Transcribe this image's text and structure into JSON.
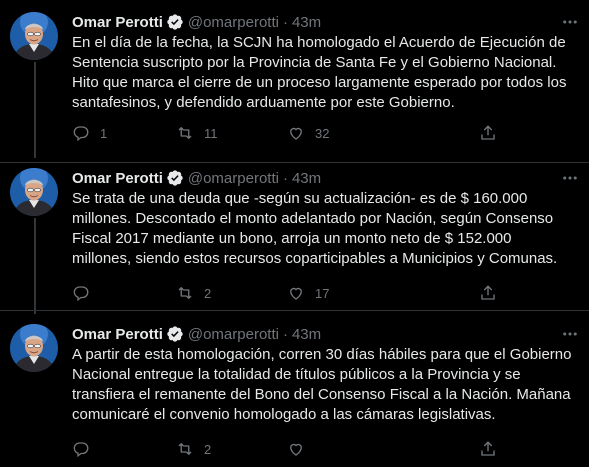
{
  "colors": {
    "background": "#000000",
    "text_primary": "#e7e9ea",
    "text_secondary": "#71767b",
    "verified": "#1d9bf0",
    "divider": "#2f3336"
  },
  "tweets": [
    {
      "author_name": "Omar Perotti",
      "author_handle": "@omarperotti",
      "separator": "·",
      "time": "43m",
      "verified_icon": "verified-badge-icon",
      "text": "En el día de la fecha, la SCJN ha homologado el Acuerdo de Ejecución de\nSentencia suscripto por la Provincia de Santa Fe y el Gobierno Nacional.\nHito que marca el cierre de un proceso largamente esperado por todos los\nsantafesinos, y defendido arduamente por este Gobierno.",
      "replies": "1",
      "retweets": "11",
      "likes": "32"
    },
    {
      "author_name": "Omar Perotti",
      "author_handle": "@omarperotti",
      "separator": "·",
      "time": "43m",
      "verified_icon": "verified-badge-icon",
      "text": "Se trata de una deuda que -según su actualización- es de $ 160.000\nmillones. Descontado el monto adelantado por Nación, según Consenso\nFiscal 2017 mediante un bono, arroja un monto neto de $ 152.000\nmillones, siendo estos recursos coparticipables a Municipios y Comunas.",
      "replies": "",
      "retweets": "2",
      "likes": "17"
    },
    {
      "author_name": "Omar Perotti",
      "author_handle": "@omarperotti",
      "separator": "·",
      "time": "43m",
      "verified_icon": "verified-badge-icon",
      "text": "A partir de esta homologación, corren 30 días hábiles para que el Gobierno\nNacional entregue la totalidad de títulos públicos a la Provincia y se\ntransfiera el remanente del Bono del Consenso Fiscal a la Nación. Mañana\ncomunicaré el convenio homologado a las cámaras legislativas.",
      "replies": "",
      "retweets": "2",
      "likes": ""
    }
  ]
}
